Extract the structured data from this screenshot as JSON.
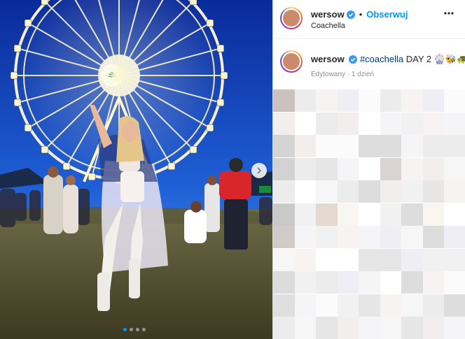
{
  "post": {
    "username": "wersow",
    "separator": "•",
    "follow_label": "Obserwuj",
    "location": "Coachella",
    "caption_hashtag": "#coachella",
    "caption_text": "DAY 2",
    "caption_emojis": "🎡🐝🐢💙",
    "edited_label": "Edytowany",
    "meta_sep": "·",
    "time_ago": "1 dzień"
  },
  "carousel": {
    "slide_count": 4,
    "active_slide": 1
  },
  "colors": {
    "accent_blue": "#0095f6",
    "text_primary": "#262626",
    "text_secondary": "#8e8e8e",
    "hashtag": "#00376b"
  },
  "icons": {
    "verified": "verified-badge-icon",
    "more": "more-options-icon",
    "next": "chevron-right-icon"
  }
}
